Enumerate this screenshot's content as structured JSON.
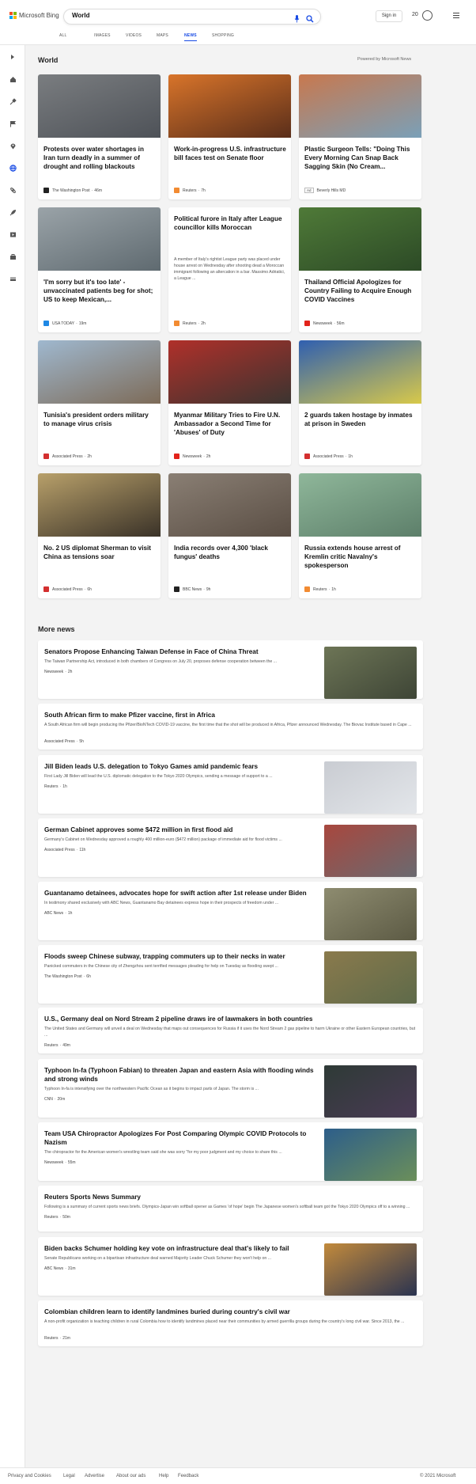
{
  "header": {
    "brand": "Microsoft Bing",
    "search_value": "World",
    "sign_in": "Sign in",
    "rewards_points": "20"
  },
  "tabs": [
    {
      "label": "ALL"
    },
    {
      "label": "IMAGES"
    },
    {
      "label": "VIDEOS"
    },
    {
      "label": "MAPS"
    },
    {
      "label": "NEWS",
      "active": true
    },
    {
      "label": "SHOPPING"
    }
  ],
  "sidebar": {
    "icons": [
      "expand-icon",
      "home-icon",
      "tools-icon",
      "flag-icon",
      "location-icon",
      "globe-icon",
      "science-icon",
      "rocket-icon",
      "entertainment-icon",
      "business-icon",
      "money-icon"
    ]
  },
  "section": {
    "title": "World",
    "powered_by": "Powered by Microsoft News"
  },
  "top_cards": [
    {
      "title": "Protests over water shortages in Iran turn deadly in a summer of drought and rolling blackouts",
      "source": "The Washington Post",
      "age": "46m",
      "icon": "wapo-icon",
      "color": "#222222",
      "img": [
        "#7a7d80",
        "#4e5258"
      ]
    },
    {
      "title": "Work-in-progress U.S. infrastructure bill faces test on Senate floor",
      "source": "Reuters",
      "age": "7h",
      "icon": "reuters-icon",
      "color": "#f28b32",
      "img": [
        "#d8742a",
        "#5a2e1a"
      ]
    },
    {
      "title": "Plastic Surgeon Tells: \"Doing This Every Morning Can Snap Back Sagging Skin (No Cream...",
      "source": "Beverly Hills MD",
      "ad": "Ad",
      "img": [
        "#c8784e",
        "#7aa0b8"
      ]
    },
    {
      "title": "'I'm sorry but it's too late' - unvaccinated patients beg for shot; US to keep Mexican,...",
      "source": "USA TODAY",
      "age": "19m",
      "icon": "usatoday-icon",
      "color": "#1e88e5",
      "img": [
        "#9aa3a8",
        "#5f6a70"
      ]
    },
    {
      "title": "Political furore in Italy after League councillor kills Moroccan",
      "snippet": "A member of Italy's rightist League party was placed under house arrest on Wednesday after shooting dead a Moroccan immigrant following an altercation in a bar. Massimo Adriatici, a League ...",
      "source": "Reuters",
      "age": "2h",
      "icon": "reuters-icon",
      "color": "#f28b32"
    },
    {
      "title": "Thailand Official Apologizes for Country Failing to Acquire Enough COVID Vaccines",
      "source": "Newsweek",
      "age": "56m",
      "icon": "newsweek-icon",
      "color": "#e2231a",
      "img": [
        "#4f7a38",
        "#2c4a26"
      ]
    },
    {
      "title": "Tunisia's president orders military to manage virus crisis",
      "source": "Associated Press",
      "age": "2h",
      "icon": "ap-icon",
      "color": "#d32f2f",
      "img": [
        "#9fb8cf",
        "#7d6b58"
      ]
    },
    {
      "title": "Myanmar Military Tries to Fire U.N. Ambassador a Second Time for 'Abuses' of Duty",
      "source": "Newsweek",
      "age": "2h",
      "icon": "newsweek-icon",
      "color": "#e2231a",
      "img": [
        "#b0302a",
        "#3b3430"
      ]
    },
    {
      "title": "2 guards taken hostage by inmates at prison in Sweden",
      "source": "Associated Press",
      "age": "1h",
      "icon": "ap-icon",
      "color": "#d32f2f",
      "img": [
        "#2f5fb0",
        "#d8c94a"
      ]
    },
    {
      "title": "No. 2 US diplomat Sherman to visit China as tensions soar",
      "source": "Associated Press",
      "age": "6h",
      "icon": "ap-icon",
      "color": "#d32f2f",
      "img": [
        "#b8a06a",
        "#3a3228"
      ]
    },
    {
      "title": "India records over 4,300 'black fungus' deaths",
      "source": "BBC News",
      "age": "9h",
      "icon": "bbc-icon",
      "color": "#222222",
      "img": [
        "#8a7f74",
        "#5a4e44"
      ]
    },
    {
      "title": "Russia extends house arrest of Kremlin critic Navalny's spokesperson",
      "source": "Reuters",
      "age": "1h",
      "icon": "reuters-icon",
      "color": "#f28b32",
      "img": [
        "#8fb79a",
        "#5d7f6a"
      ]
    }
  ],
  "more_news": {
    "title": "More news",
    "items": [
      {
        "title": "Senators Propose Enhancing Taiwan Defense in Face of China Threat",
        "snippet": "The Taiwan Partnership Act, introduced in both chambers of Congress on July 20, proposes defense cooperation between the ...",
        "source": "Newsweek",
        "age": "2h",
        "icon": "newsweek-icon",
        "color": "#e2231a",
        "thumb": [
          "#6d7556",
          "#3e4536"
        ]
      },
      {
        "title": "South African firm to make Pfizer vaccine, first in Africa",
        "snippet": "A South African firm will begin producing the Pfizer/BioNTech COVID-19 vaccine, the first time that the shot will be produced in Africa, Pfizer announced Wednesday. The Biovac Institute based in Cape ...",
        "source": "Associated Press",
        "age": "5h",
        "icon": "ap-icon",
        "color": "#d32f2f"
      },
      {
        "title": "Jill Biden leads U.S. delegation to Tokyo Games amid pandemic fears",
        "snippet": "First Lady Jill Biden will lead the U.S. diplomatic delegation to the Tokyo 2020 Olympics, sending a message of support to a ...",
        "source": "Reuters",
        "age": "1h",
        "icon": "reuters-icon",
        "color": "#f28b32",
        "thumb": [
          "#c9ccd2",
          "#e3e6ea"
        ]
      },
      {
        "title": "German Cabinet approves some $472 million in first flood aid",
        "snippet": "Germany's Cabinet on Wednesday approved a roughly 400 million-euro ($472 million) package of immediate aid for flood victims ...",
        "source": "Associated Press",
        "age": "11h",
        "icon": "ap-icon",
        "color": "#d32f2f",
        "thumb": [
          "#a8473e",
          "#6a6a70"
        ]
      },
      {
        "title": "Guantanamo detainees, advocates hope for swift action after 1st release under Biden",
        "snippet": "In testimony shared exclusively with ABC News, Guantanamo Bay detainees express hope in their prospects of freedom under ...",
        "source": "ABC News",
        "age": "1h",
        "icon": "abc-icon",
        "color": "#333333",
        "thumb": [
          "#8e8c70",
          "#5c5a44"
        ]
      },
      {
        "title": "Floods sweep Chinese subway, trapping commuters up to their necks in water",
        "snippet": "Panicked commuters in the Chinese city of Zhengzhou sent terrified messages pleading for help on Tuesday as flooding swept ...",
        "source": "The Washington Post",
        "age": "6h",
        "icon": "wapo-icon",
        "color": "#222222",
        "thumb": [
          "#8a7a4c",
          "#5e6a4a"
        ]
      },
      {
        "title": "U.S., Germany deal on Nord Stream 2 pipeline draws ire of lawmakers in both countries",
        "snippet": "The United States and Germany will unveil a deal on Wednesday that maps out consequences for Russia if it uses the Nord Stream 2 gas pipeline to harm Ukraine or other Eastern European countries, but ...",
        "source": "Reuters",
        "age": "49m",
        "icon": "reuters-icon",
        "color": "#f28b32"
      },
      {
        "title": "Typhoon In-fa (Typhoon Fabian) to threaten Japan and eastern Asia with flooding winds and strong winds",
        "snippet": "Typhoon In-fa is intensifying over the northwestern Pacific Ocean as it begins to impact parts of Japan. The storm is ...",
        "source": "CNN",
        "age": "20m",
        "icon": "cnn-icon",
        "color": "#cc0000",
        "thumb": [
          "#2e3a36",
          "#4a3a55"
        ]
      },
      {
        "title": "Team USA Chiropractor Apologizes For Post Comparing Olympic COVID Protocols to Nazism",
        "snippet": "The chiropractor for the American women's wrestling team said she was sorry \"for my poor judgment and my choice to share this ...",
        "source": "Newsweek",
        "age": "55m",
        "icon": "newsweek-icon",
        "color": "#e2231a",
        "thumb": [
          "#2d5e8a",
          "#6b8f5a"
        ]
      },
      {
        "title": "Reuters Sports News Summary",
        "snippet": "Following is a summary of current sports news briefs. Olympics-Japan win softball opener as Games 'of hope' begin The Japanese women's softball team got the Tokyo 2020 Olympics off to a winning ...",
        "source": "Reuters",
        "age": "50m",
        "icon": "reuters-icon",
        "color": "#f28b32"
      },
      {
        "title": "Biden backs Schumer holding key vote on infrastructure deal that's likely to fail",
        "snippet": "Senate Republicans working on a bipartisan infrastructure deal warned Majority Leader Chuck Schumer they won't help on ...",
        "source": "ABC News",
        "age": "31m",
        "icon": "abc-icon",
        "color": "#333333",
        "thumb": [
          "#c28a3c",
          "#2a3350"
        ]
      },
      {
        "title": "Colombian children learn to identify landmines buried during country's civil war",
        "snippet": "A non-profit organization is teaching children in rural Colombia how to identify landmines placed near their communities by armed guerrilla groups during the country's long civil war. Since 2013, the ...",
        "source": "Reuters",
        "age": "21m",
        "icon": "reuters-icon",
        "color": "#f28b32"
      }
    ]
  },
  "footer": {
    "links": [
      "Privacy and Cookies",
      "Legal",
      "Advertise",
      "About our ads",
      "Help",
      "Feedback"
    ],
    "copyright": "© 2021 Microsoft"
  }
}
